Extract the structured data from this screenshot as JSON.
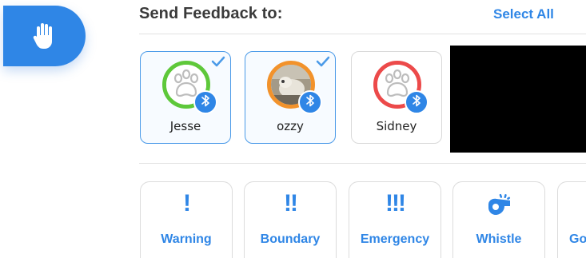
{
  "header": {
    "title": "Send Feedback to:",
    "select_all": "Select All"
  },
  "colors": {
    "accent": "#2f86e6",
    "ring_green": "#5ec83a",
    "ring_orange": "#f2922b",
    "ring_red": "#ec4a4a"
  },
  "hand_tab": {
    "icon": "hand-icon"
  },
  "pets": [
    {
      "name": "Jesse",
      "selected": true,
      "ring": "green",
      "avatar": "paw-icon",
      "badge": "bluetooth-icon"
    },
    {
      "name": "ozzy",
      "selected": true,
      "ring": "orange",
      "avatar": "dog-photo",
      "badge": "bluetooth-icon"
    },
    {
      "name": "Sidney",
      "selected": false,
      "ring": "red",
      "avatar": "paw-icon",
      "badge": "bluetooth-icon"
    }
  ],
  "actions": [
    {
      "label": "Warning",
      "icon": "!",
      "icon_name": "single-exclamation-icon"
    },
    {
      "label": "Boundary",
      "icon": "!!",
      "icon_name": "double-exclamation-icon"
    },
    {
      "label": "Emergency",
      "icon": "!!!",
      "icon_name": "triple-exclamation-icon"
    },
    {
      "label": "Whistle",
      "icon_name": "whistle-icon"
    },
    {
      "label": "Go",
      "icon_name": ""
    }
  ]
}
